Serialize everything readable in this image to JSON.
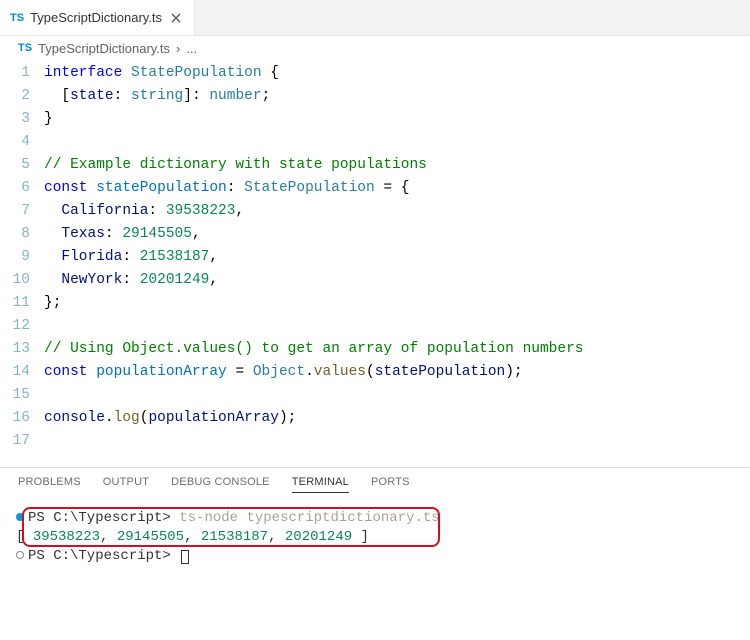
{
  "tab": {
    "icon": "TS",
    "filename": "TypeScriptDictionary.ts"
  },
  "breadcrumb": {
    "icon": "TS",
    "filename": "TypeScriptDictionary.ts",
    "sep": "›",
    "rest": "..."
  },
  "code": {
    "lines": [
      {
        "n": "1",
        "tokens": [
          {
            "t": "interface",
            "c": "tok-kw"
          },
          {
            "t": " "
          },
          {
            "t": "StatePopulation",
            "c": "tok-type"
          },
          {
            "t": " {"
          }
        ]
      },
      {
        "n": "2",
        "tokens": [
          {
            "t": "  ["
          },
          {
            "t": "state",
            "c": "tok-prop"
          },
          {
            "t": ": "
          },
          {
            "t": "string",
            "c": "tok-type"
          },
          {
            "t": "]: "
          },
          {
            "t": "number",
            "c": "tok-type"
          },
          {
            "t": ";"
          }
        ]
      },
      {
        "n": "3",
        "tokens": [
          {
            "t": "}"
          }
        ]
      },
      {
        "n": "4",
        "tokens": []
      },
      {
        "n": "5",
        "tokens": [
          {
            "t": "// Example dictionary with state populations",
            "c": "tok-com"
          }
        ]
      },
      {
        "n": "6",
        "tokens": [
          {
            "t": "const",
            "c": "tok-kw"
          },
          {
            "t": " "
          },
          {
            "t": "statePopulation",
            "c": "tok-var"
          },
          {
            "t": ": "
          },
          {
            "t": "StatePopulation",
            "c": "tok-type"
          },
          {
            "t": " = {"
          }
        ]
      },
      {
        "n": "7",
        "tokens": [
          {
            "t": "  "
          },
          {
            "t": "California",
            "c": "tok-prop"
          },
          {
            "t": ": "
          },
          {
            "t": "39538223",
            "c": "tok-num"
          },
          {
            "t": ","
          }
        ]
      },
      {
        "n": "8",
        "tokens": [
          {
            "t": "  "
          },
          {
            "t": "Texas",
            "c": "tok-prop"
          },
          {
            "t": ": "
          },
          {
            "t": "29145505",
            "c": "tok-num"
          },
          {
            "t": ","
          }
        ]
      },
      {
        "n": "9",
        "tokens": [
          {
            "t": "  "
          },
          {
            "t": "Florida",
            "c": "tok-prop"
          },
          {
            "t": ": "
          },
          {
            "t": "21538187",
            "c": "tok-num"
          },
          {
            "t": ","
          }
        ]
      },
      {
        "n": "10",
        "tokens": [
          {
            "t": "  "
          },
          {
            "t": "NewYork",
            "c": "tok-prop"
          },
          {
            "t": ": "
          },
          {
            "t": "20201249",
            "c": "tok-num"
          },
          {
            "t": ","
          }
        ]
      },
      {
        "n": "11",
        "tokens": [
          {
            "t": "};"
          }
        ]
      },
      {
        "n": "12",
        "tokens": []
      },
      {
        "n": "13",
        "tokens": [
          {
            "t": "// Using Object.values() to get an array of population numbers",
            "c": "tok-com"
          }
        ]
      },
      {
        "n": "14",
        "tokens": [
          {
            "t": "const",
            "c": "tok-kw"
          },
          {
            "t": " "
          },
          {
            "t": "populationArray",
            "c": "tok-var"
          },
          {
            "t": " = "
          },
          {
            "t": "Object",
            "c": "tok-obj"
          },
          {
            "t": "."
          },
          {
            "t": "values",
            "c": "tok-fn"
          },
          {
            "t": "("
          },
          {
            "t": "statePopulation",
            "c": "tok-prop"
          },
          {
            "t": ");"
          }
        ]
      },
      {
        "n": "15",
        "tokens": []
      },
      {
        "n": "16",
        "tokens": [
          {
            "t": "console",
            "c": "tok-prop"
          },
          {
            "t": "."
          },
          {
            "t": "log",
            "c": "tok-fn"
          },
          {
            "t": "("
          },
          {
            "t": "populationArray",
            "c": "tok-prop"
          },
          {
            "t": ");"
          }
        ]
      },
      {
        "n": "17",
        "tokens": []
      }
    ]
  },
  "panel": {
    "tabs": {
      "problems": "PROBLEMS",
      "output": "OUTPUT",
      "debug": "DEBUG CONSOLE",
      "terminal": "TERMINAL",
      "ports": "PORTS"
    },
    "active": "terminal"
  },
  "terminal": {
    "prompt1_path": "PS C:\\Typescript> ",
    "prompt1_cmd": "ts-node typescriptdictionary.ts",
    "output": "[ 39538223, 29145505, 21538187, 20201249 ]",
    "output_nums": [
      "39538223",
      "29145505",
      "21538187",
      "20201249"
    ],
    "prompt2_path": "PS C:\\Typescript> "
  }
}
